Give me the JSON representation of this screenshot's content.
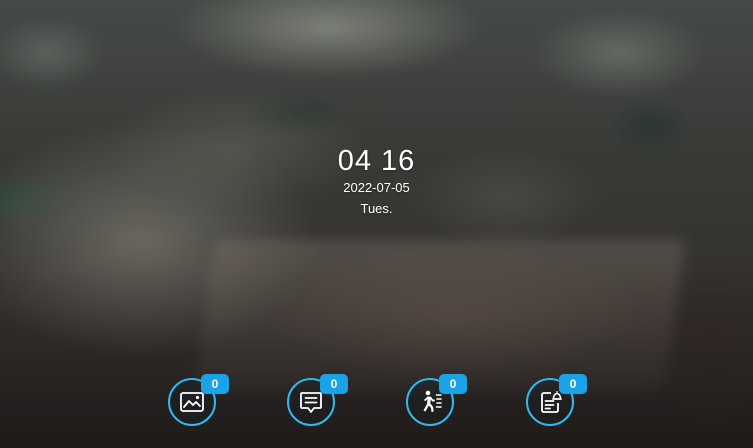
{
  "clock": {
    "time": "04 16",
    "date": "2022-07-05",
    "weekday": "Tues."
  },
  "quick_buttons": [
    {
      "icon": "photo-gallery-icon",
      "count": "0"
    },
    {
      "icon": "message-icon",
      "count": "0"
    },
    {
      "icon": "motion-detection-icon",
      "count": "0"
    },
    {
      "icon": "alarm-record-icon",
      "count": "0"
    }
  ],
  "colors": {
    "accent": "#32b8ef",
    "badge": "#1ba3e8"
  }
}
